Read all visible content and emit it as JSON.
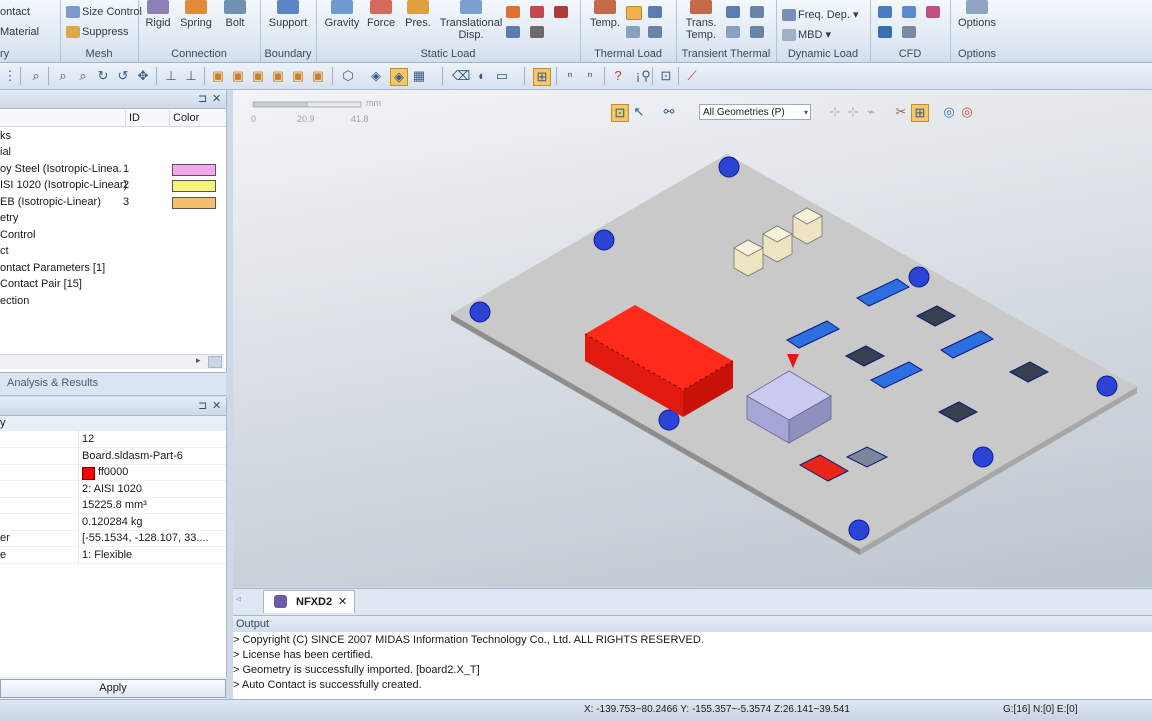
{
  "ribbon": {
    "groups": [
      {
        "label": "ry",
        "items": [
          "ontact",
          "Material"
        ]
      },
      {
        "label": "Mesh",
        "items": [
          "Size Control",
          "Suppress"
        ]
      },
      {
        "label": "Connection",
        "items": [
          "Rigid",
          "Spring",
          "Bolt"
        ]
      },
      {
        "label": "Boundary",
        "items": [
          "Support"
        ]
      },
      {
        "label": "Static Load",
        "items": [
          "Gravity",
          "Force",
          "Pres.",
          "Translational Disp."
        ]
      },
      {
        "label": "Thermal Load",
        "items": [
          "Temp."
        ]
      },
      {
        "label": "Transient Thermal",
        "items": [
          "Trans. Temp."
        ]
      },
      {
        "label": "Dynamic Load",
        "items": [
          "Freq. Dep.",
          "MBD"
        ]
      },
      {
        "label": "CFD",
        "items": []
      },
      {
        "label": "Options",
        "items": [
          "Options"
        ]
      }
    ]
  },
  "tree_panel": {
    "col_id": "ID",
    "col_color": "Color",
    "rows": [
      {
        "label": "ks"
      },
      {
        "label": "ial"
      },
      {
        "label": "oy Steel (Isotropic-Linea.",
        "id": "1",
        "color": "#f2a7ee"
      },
      {
        "label": "ISI 1020 (Isotropic-Linear)",
        "id": "2",
        "color": "#f6f27a"
      },
      {
        "label": "EB (Isotropic-Linear)",
        "id": "3",
        "color": "#f5bd6c"
      },
      {
        "label": "etry"
      },
      {
        "label": "Control"
      },
      {
        "label": "ct"
      },
      {
        "label": "ontact Parameters [1]"
      },
      {
        "label": "Contact Pair [15]"
      },
      {
        "label": "ection"
      }
    ]
  },
  "tabs": {
    "analysis": "Analysis & Results"
  },
  "props_panel": {
    "header": "y",
    "rows": [
      {
        "key": "",
        "value": "12"
      },
      {
        "key": "",
        "value": "Board.sldasm-Part-6"
      },
      {
        "key": "",
        "value": "ff0000",
        "swatch": "#ff0000"
      },
      {
        "key": "",
        "value": "2: AISI 1020"
      },
      {
        "key": "",
        "value": "15225.8 mm³"
      },
      {
        "key": "",
        "value": "0.120284 kg"
      },
      {
        "key": "er",
        "value": "[-55.1534, -128.107, 33...."
      },
      {
        "key": "e",
        "value": "1: Flexible"
      }
    ],
    "apply": "Apply"
  },
  "viewport": {
    "scale": {
      "unit": "mm",
      "ticks": [
        "0",
        "20.9",
        "41.8"
      ]
    },
    "geometry_filter": "All Geometries (P)"
  },
  "doc_tab": "NFXD2",
  "output": {
    "title": "Output",
    "lines": [
      "> Copyright (C) SINCE 2007 MIDAS Information Technology Co., Ltd. ALL RIGHTS RESERVED.",
      "> License has been certified.",
      "> Geometry is successfully imported. [board2.X_T]",
      "> Auto Contact is successfully created."
    ]
  },
  "status": {
    "coords": "X: -139.753~80.2466 Y: -155.357~-5.3574 Z:26.141~39.541",
    "counts": "G:[16] N:[0] E:[0]"
  }
}
